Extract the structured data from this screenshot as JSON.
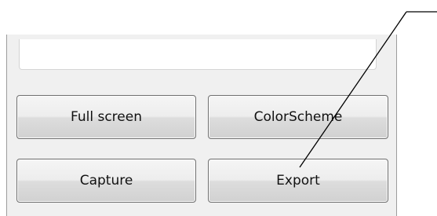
{
  "buttons": {
    "full_screen": "Full screen",
    "color_scheme": "ColorScheme",
    "capture": "Capture",
    "export": "Export"
  }
}
